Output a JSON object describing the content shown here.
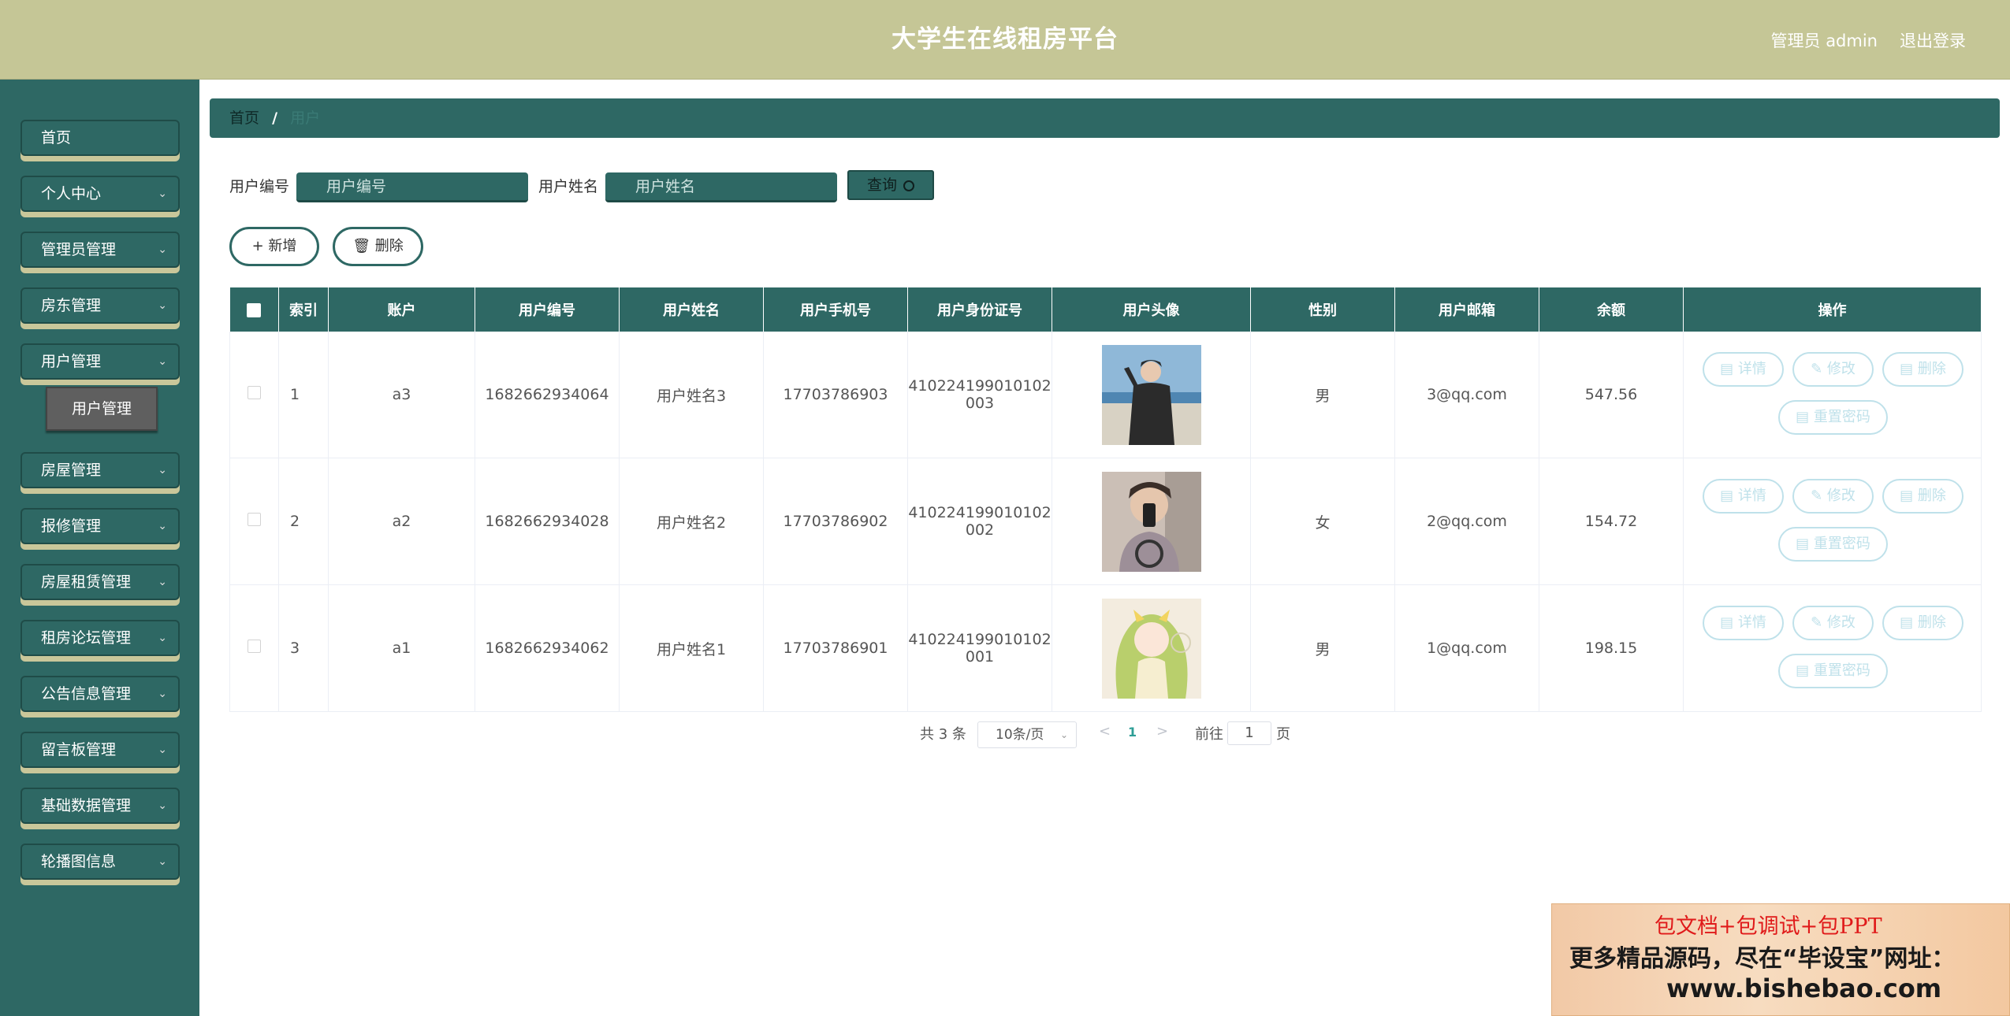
{
  "header": {
    "title": "大学生在线租房平台",
    "user": "管理员 admin",
    "logout": "退出登录"
  },
  "sidebar": {
    "items": [
      {
        "label": "首页",
        "has_chevron": false
      },
      {
        "label": "个人中心",
        "has_chevron": true
      },
      {
        "label": "管理员管理",
        "has_chevron": true
      },
      {
        "label": "房东管理",
        "has_chevron": true
      },
      {
        "label": "用户管理",
        "has_chevron": true
      },
      {
        "label": "房屋管理",
        "has_chevron": true
      },
      {
        "label": "报修管理",
        "has_chevron": true
      },
      {
        "label": "房屋租赁管理",
        "has_chevron": true
      },
      {
        "label": "租房论坛管理",
        "has_chevron": true
      },
      {
        "label": "公告信息管理",
        "has_chevron": true
      },
      {
        "label": "留言板管理",
        "has_chevron": true
      },
      {
        "label": "基础数据管理",
        "has_chevron": true
      },
      {
        "label": "轮播图信息",
        "has_chevron": true
      }
    ],
    "active_sub": "用户管理"
  },
  "breadcrumb": {
    "home": "首页",
    "separator": "/",
    "current": "用户"
  },
  "search": {
    "user_no_label": "用户编号",
    "user_no_placeholder": "用户编号",
    "user_name_label": "用户姓名",
    "user_name_placeholder": "用户姓名",
    "query_label": "查询"
  },
  "actions": {
    "add_label": "新增",
    "delete_label": "删除"
  },
  "table": {
    "columns": [
      "索引",
      "账户",
      "用户编号",
      "用户姓名",
      "用户手机号",
      "用户身份证号",
      "用户头像",
      "性别",
      "用户邮箱",
      "余额",
      "操作"
    ],
    "rows": [
      {
        "index": "1",
        "account": "a3",
        "user_no": "1682662934064",
        "name": "用户姓名3",
        "phone": "17703786903",
        "id_card_1": "410224199010102",
        "id_card_2": "003",
        "gender": "男",
        "email": "3@qq.com",
        "balance": "547.56",
        "avatar": "avatar-dark-jacket"
      },
      {
        "index": "2",
        "account": "a2",
        "user_no": "1682662934028",
        "name": "用户姓名2",
        "phone": "17703786902",
        "id_card_1": "410224199010102",
        "id_card_2": "002",
        "gender": "女",
        "email": "2@qq.com",
        "balance": "154.72",
        "avatar": "avatar-mirror-selfie"
      },
      {
        "index": "3",
        "account": "a1",
        "user_no": "1682662934062",
        "name": "用户姓名1",
        "phone": "17703786901",
        "id_card_1": "410224199010102",
        "id_card_2": "001",
        "gender": "男",
        "email": "1@qq.com",
        "balance": "198.15",
        "avatar": "avatar-anime-girl"
      }
    ],
    "row_ops": {
      "detail": "详情",
      "edit": "修改",
      "delete": "删除",
      "reset": "重置密码"
    }
  },
  "pagination": {
    "total": "共 3 条",
    "page_size": "10条/页",
    "current_page": "1",
    "goto_prefix": "前往",
    "goto_value": "1",
    "goto_suffix": "页"
  },
  "watermark": {
    "line1": "包文档+包调试+包PPT",
    "line2": "更多精品源码，尽在“毕设宝”网址：",
    "line3": "www.bishebao.com"
  },
  "colors": {
    "header_bg": "#c5c696",
    "primary": "#2e6864",
    "nav_shadow": "#c9c79a",
    "op_border": "#bfe1ea"
  }
}
